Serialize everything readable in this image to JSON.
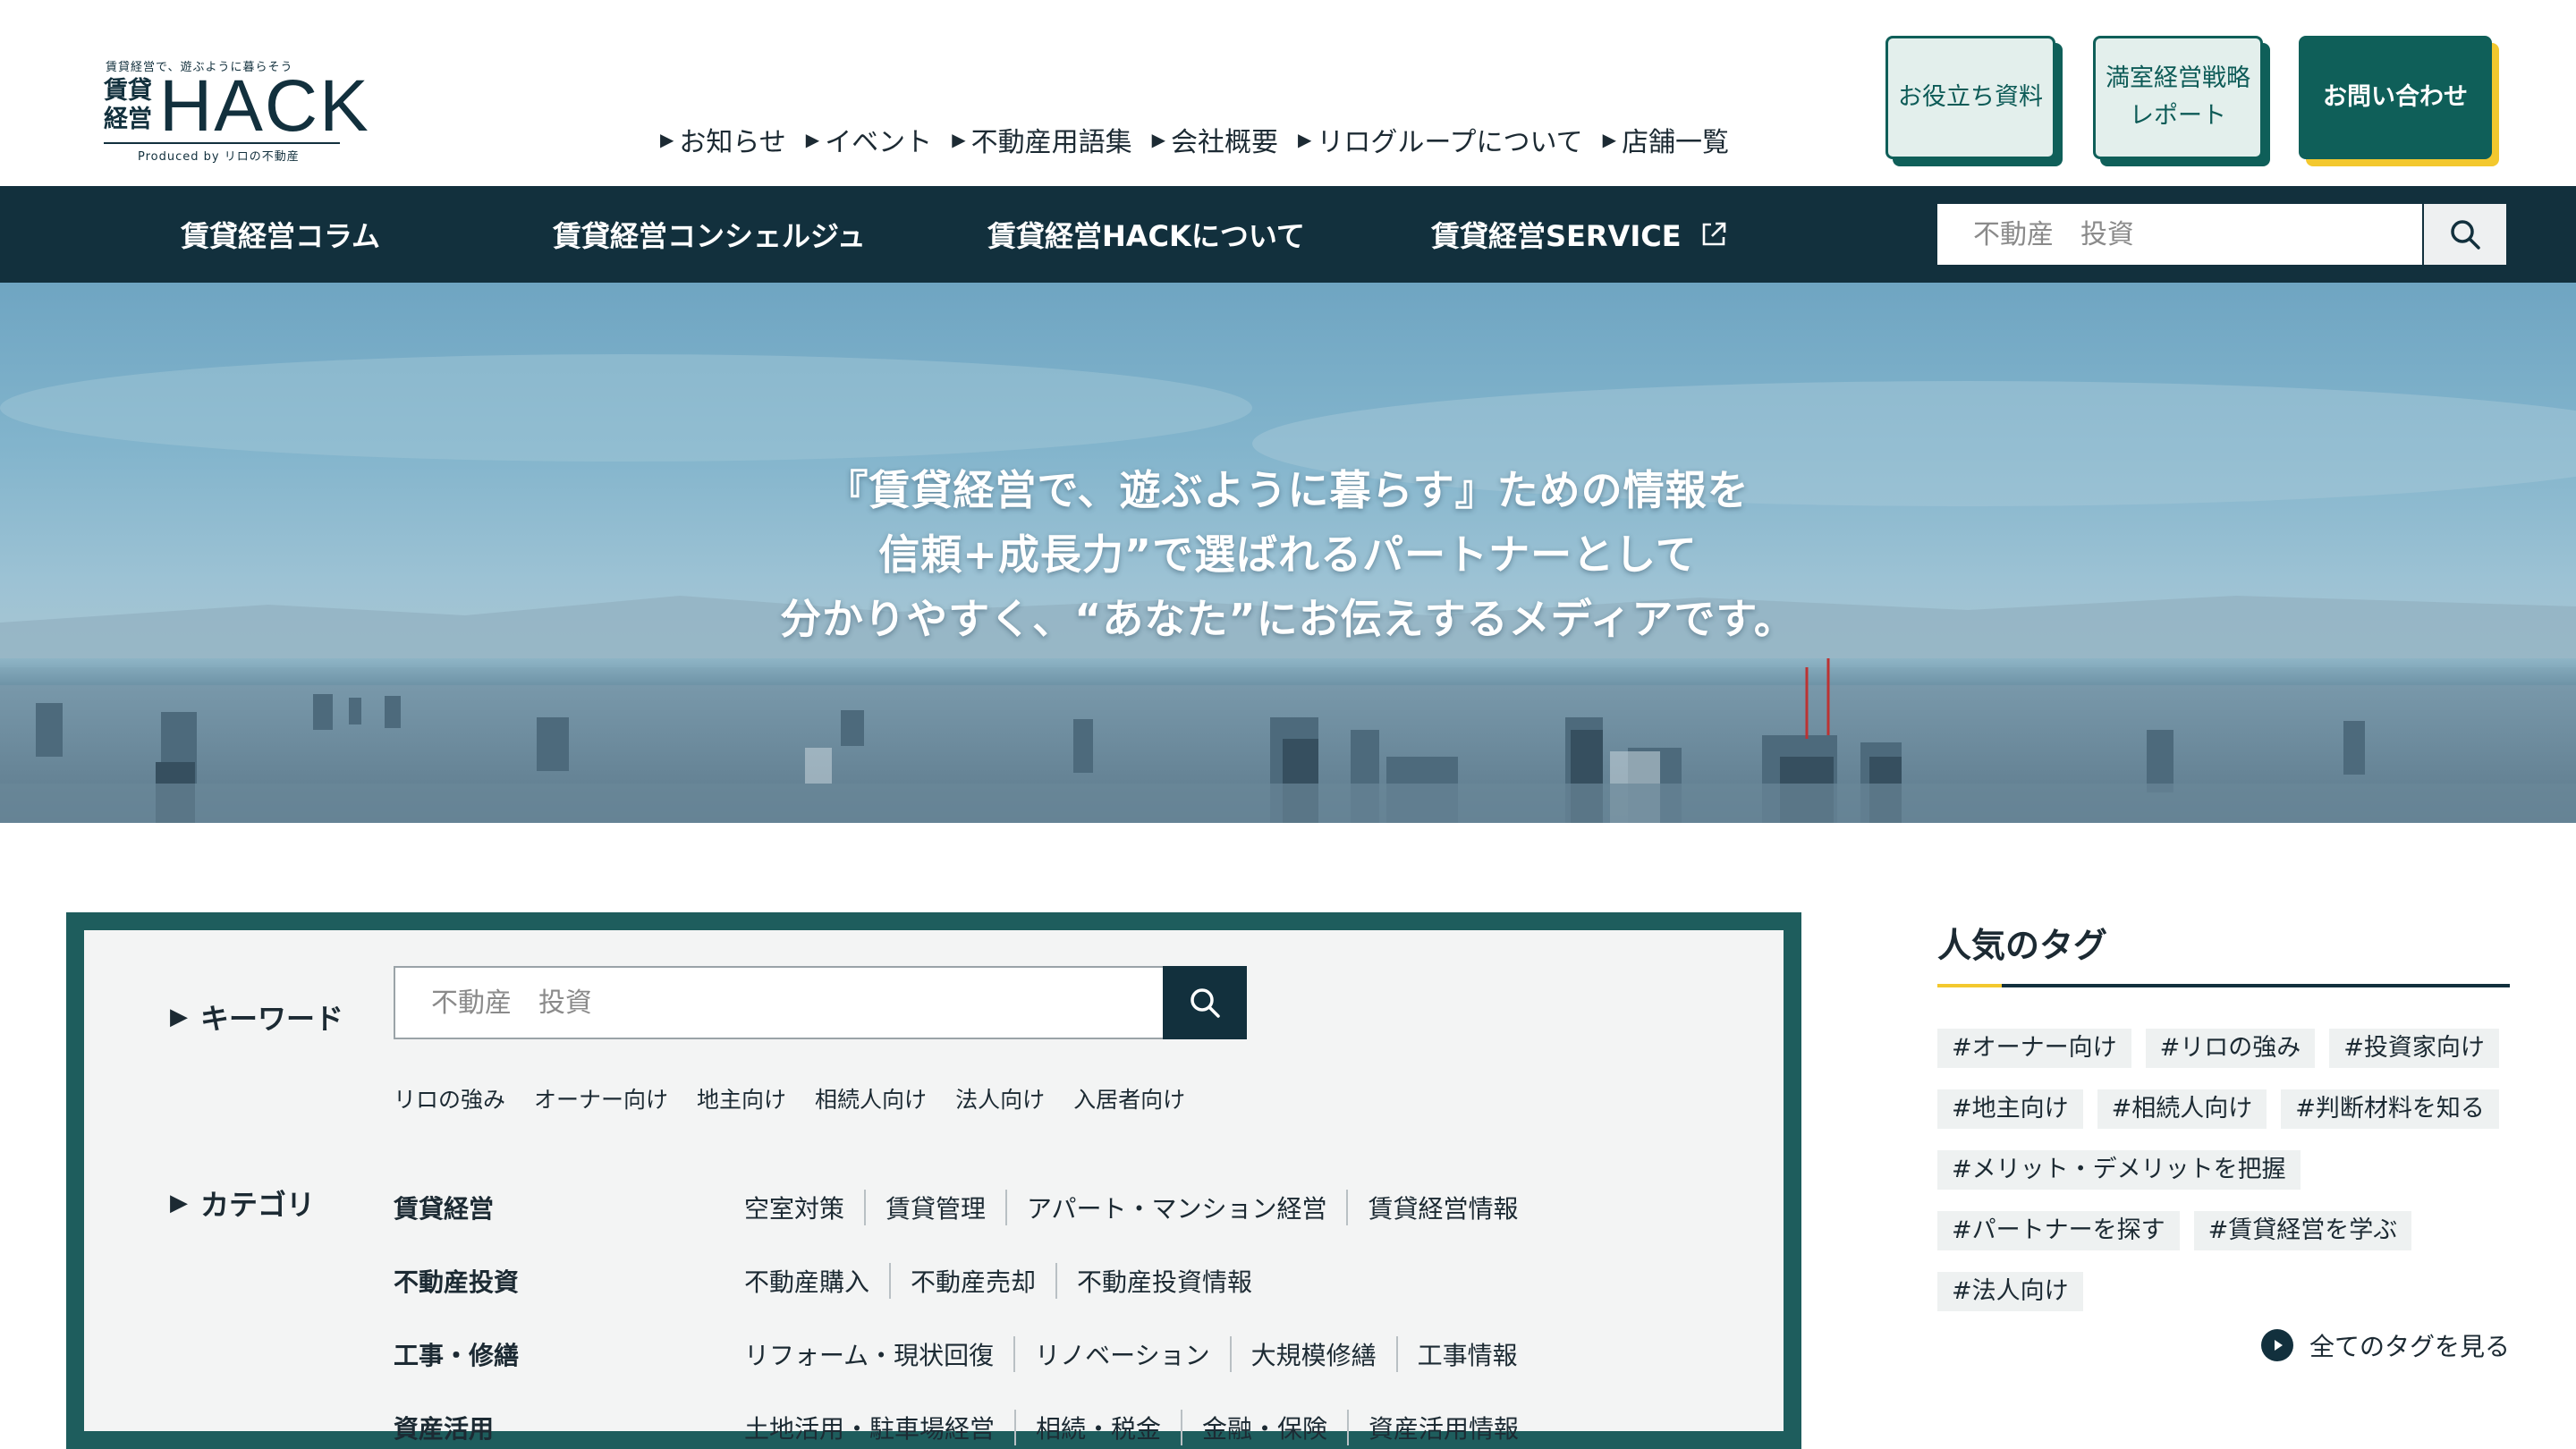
{
  "logo": {
    "tagline": "賃貸経営で、遊ぶように暮らそう",
    "kanji": "賃貸経営",
    "wordmark": "HACK",
    "produced": "Produced by リロの不動産"
  },
  "top_nav": [
    {
      "label": "お知らせ"
    },
    {
      "label": "イベント"
    },
    {
      "label": "不動産用語集"
    },
    {
      "label": "会社概要"
    },
    {
      "label": "リログループについて"
    },
    {
      "label": "店舗一覧"
    }
  ],
  "header_buttons": {
    "resources": "お役立ち資料",
    "report_line1": "満室経営戦略",
    "report_line2": "レポート",
    "contact": "お問い合わせ"
  },
  "main_nav": [
    {
      "label": "賃貸経営コラム"
    },
    {
      "label": "賃貸経営コンシェルジュ"
    },
    {
      "label": "賃貸経営HACKについて"
    },
    {
      "label": "賃貸経営SERVICE"
    }
  ],
  "nav_search": {
    "placeholder": "不動産　投資"
  },
  "hero": {
    "line1": "『賃貸経営で、遊ぶように暮らす』ための情報を",
    "line2": "信頼+成長力”で選ばれるパートナーとして",
    "line3": "分かりやすく、“あなた”にお伝えするメディアです。"
  },
  "search_panel": {
    "keyword_label": "キーワード",
    "placeholder": "不動産　投資",
    "keyword_links": [
      "リロの強み",
      "オーナー向け",
      "地主向け",
      "相続人向け",
      "法人向け",
      "入居者向け"
    ],
    "category_label": "カテゴリ",
    "categories": [
      {
        "name": "賃貸経営",
        "subs": [
          "空室対策",
          "賃貸管理",
          "アパート・マンション経営",
          "賃貸経営情報"
        ]
      },
      {
        "name": "不動産投資",
        "subs": [
          "不動産購入",
          "不動産売却",
          "不動産投資情報"
        ]
      },
      {
        "name": "工事・修繕",
        "subs": [
          "リフォーム・現状回復",
          "リノベーション",
          "大規模修繕",
          "工事情報"
        ]
      },
      {
        "name": "資産活用",
        "subs": [
          "土地活用・駐車場経営",
          "相続・税金",
          "金融・保険",
          "資産活用情報"
        ]
      }
    ]
  },
  "sidebar": {
    "title": "人気のタグ",
    "tags": [
      "#オーナー向け",
      "#リロの強み",
      "#投資家向け",
      "#地主向け",
      "#相続人向け",
      "#判断材料を知る",
      "#メリット・デメリットを把握",
      "#パートナーを探す",
      "#賃貸経営を学ぶ",
      "#法人向け"
    ],
    "all_tags": "全てのタグを見る"
  },
  "colors": {
    "navy": "#12303d",
    "teal": "#0f5f59",
    "panel_border": "#1e5d5d",
    "accent_yellow": "#f3c82e",
    "light_teal": "#e3efec"
  }
}
